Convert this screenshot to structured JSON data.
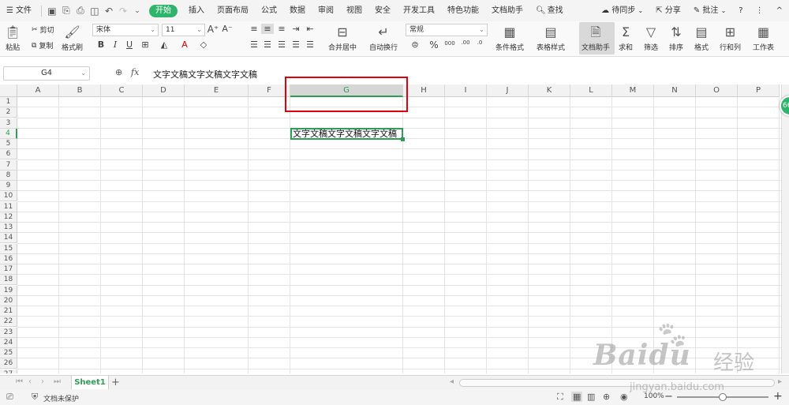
{
  "menubar": {
    "file": "文件",
    "tabs": [
      "开始",
      "插入",
      "页面布局",
      "公式",
      "数据",
      "审阅",
      "视图",
      "安全",
      "开发工具",
      "特色功能",
      "文档助手"
    ],
    "active_tab": "开始",
    "search": "查找",
    "sync": "待同步",
    "share": "分享",
    "comment": "批注",
    "help_icon": "?",
    "more_icon": "⋮",
    "collapse_icon": "^"
  },
  "ribbon": {
    "paste": "粘贴",
    "cut": "剪切",
    "copy": "复制",
    "format_painter": "格式刷",
    "font_name": "宋体",
    "font_size": "11",
    "merge_center": "合并居中",
    "auto_wrap": "自动换行",
    "number_format": "常规",
    "cond_format": "条件格式",
    "table_style": "表格样式",
    "doc_assistant": "文档助手",
    "sum": "求和",
    "filter": "筛选",
    "sort": "排序",
    "format": "格式",
    "row_col": "行和列",
    "worksheet": "工作表"
  },
  "formula": {
    "cell_ref": "G4",
    "fx": "fx",
    "value": "文字文稿文字文稿文字文稿"
  },
  "grid": {
    "columns": [
      "A",
      "B",
      "C",
      "D",
      "E",
      "F",
      "G",
      "H",
      "I",
      "J",
      "K",
      "L",
      "M",
      "N",
      "O",
      "P"
    ],
    "rows": [
      "1",
      "2",
      "3",
      "4",
      "5",
      "6",
      "7",
      "8",
      "9",
      "10",
      "11",
      "12",
      "13",
      "14",
      "15",
      "16",
      "17",
      "18",
      "19",
      "20",
      "21",
      "22",
      "23",
      "24",
      "25",
      "26",
      "27"
    ],
    "selected_column": "G",
    "selected_row": "4",
    "active_cell_text": "文字文稿文字文稿文字文稿"
  },
  "sheets": {
    "tabs": [
      "Sheet1"
    ],
    "add": "+"
  },
  "status": {
    "protection": "文档未保护",
    "zoom": "100%",
    "zoom_fraction": 0.5,
    "minus": "−",
    "plus": "+"
  },
  "bubble": {
    "label": "66"
  },
  "watermark": {
    "logo": "Baidu",
    "cn": "经验",
    "url": "jingyan.baidu.com"
  }
}
